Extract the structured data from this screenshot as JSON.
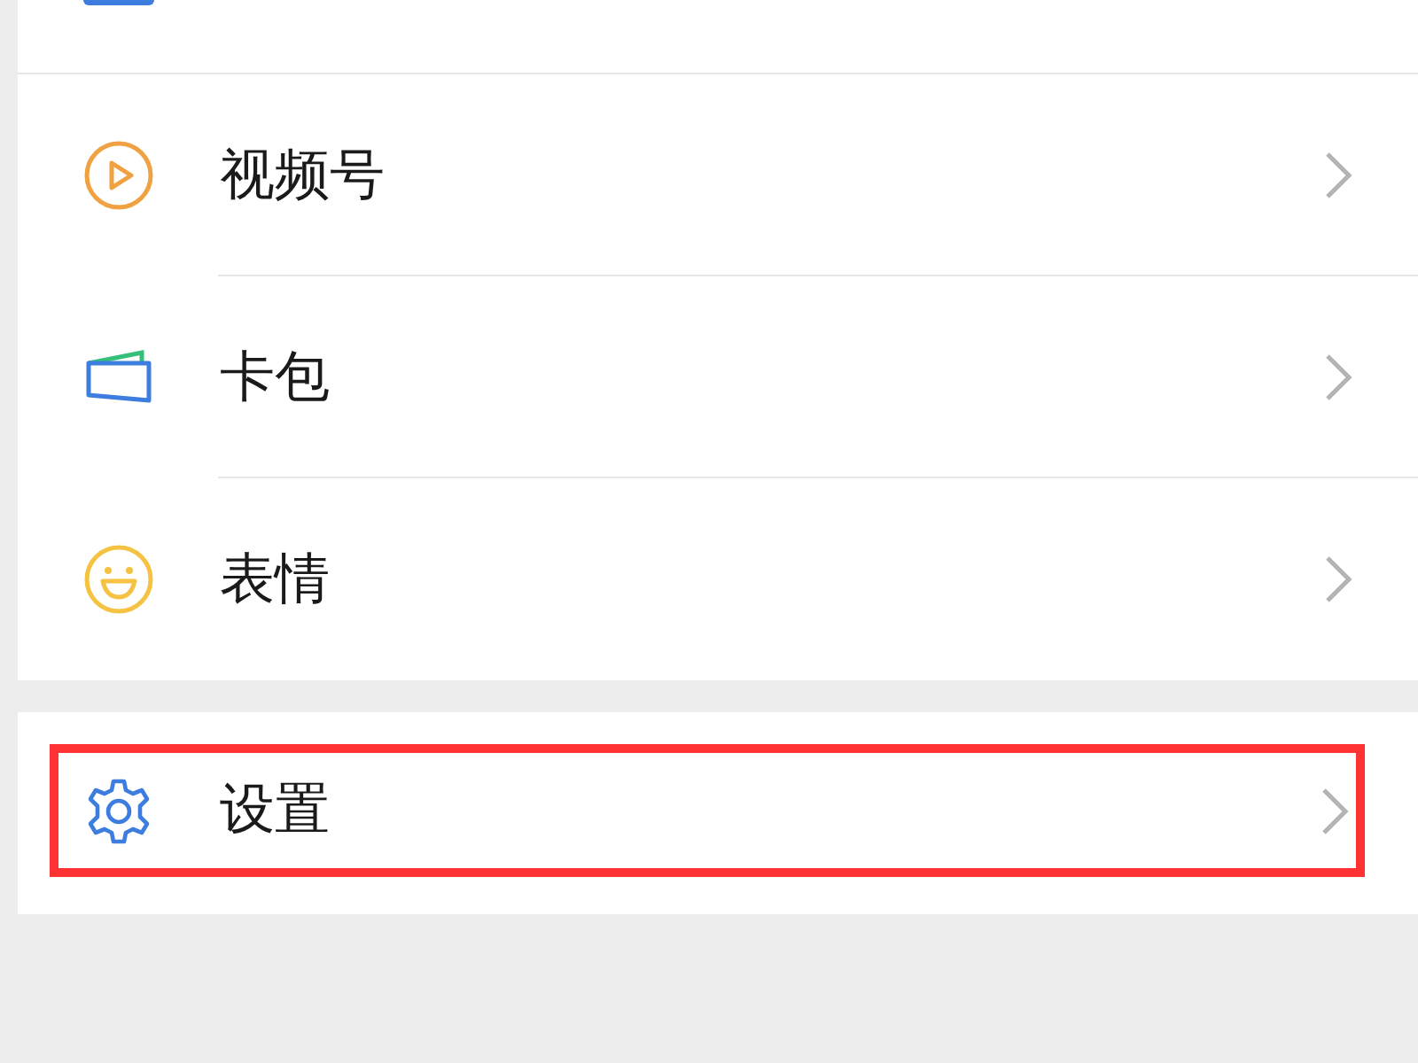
{
  "groups": [
    {
      "items": [
        {
          "kind": "cut"
        },
        {
          "kind": "play",
          "label": "视频号"
        },
        {
          "kind": "card",
          "label": "卡包"
        },
        {
          "kind": "smile",
          "label": "表情"
        }
      ]
    },
    {
      "items": [
        {
          "kind": "gear",
          "label": "设置",
          "highlighted": true
        }
      ]
    }
  ]
}
